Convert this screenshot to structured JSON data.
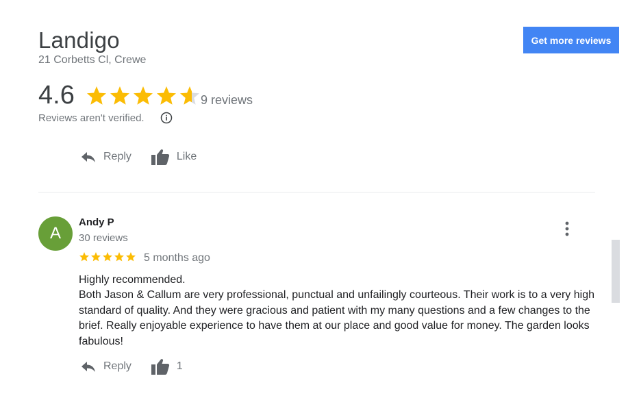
{
  "business": {
    "name": "Landigo",
    "address": "21 Corbetts Cl, Crewe"
  },
  "header": {
    "get_more_label": "Get more reviews"
  },
  "summary": {
    "rating_text": "4.6",
    "rating_value": 4.6,
    "star_count": 5,
    "reviews_text": "9 reviews",
    "verified_note": "Reviews aren't verified."
  },
  "owner_actions": {
    "reply_label": "Reply",
    "like_label": "Like"
  },
  "review": {
    "avatar_letter": "A",
    "avatar_color": "#689f38",
    "name": "Andy P",
    "reviewer_reviews": "30 reviews",
    "rating_value": 5,
    "time": "5 months ago",
    "text_line1": "Highly recommended.",
    "text_body": "Both Jason & Callum are very professional, punctual and unfailingly courteous. Their work is to a very high standard of quality. And they were gracious and patient with my many questions and a few changes to the brief. Really enjoyable experience to have them at our place and good value for money. The garden looks fabulous!",
    "reply_label": "Reply",
    "like_count": "1"
  },
  "colors": {
    "star": "#fbbc04",
    "star_empty": "#dadce0",
    "accent": "#4285f4"
  },
  "icons": [
    "star-icon",
    "info-icon",
    "reply-icon",
    "thumbs-up-icon",
    "more-vert-icon"
  ]
}
